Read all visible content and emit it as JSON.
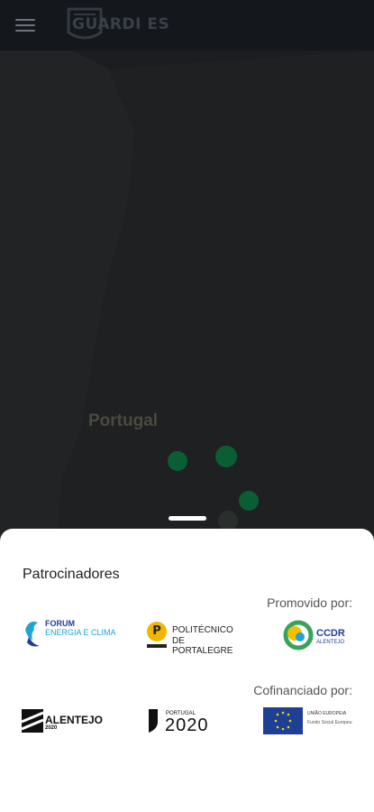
{
  "app": {
    "logo_text": "GUARDI ES"
  },
  "map": {
    "country_label": "Portugal",
    "markers": [
      {
        "name": "marker-1",
        "color": "#0b5e33"
      },
      {
        "name": "marker-2",
        "color": "#0b5e33"
      },
      {
        "name": "marker-3",
        "color": "#0b5e33"
      },
      {
        "name": "marker-4",
        "color": "#2a2e2c"
      }
    ]
  },
  "sheet": {
    "title": "Patrocinadores",
    "promoted_label": "Promovido por:",
    "cofinanced_label": "Cofinanciado por:",
    "promoted": [
      {
        "name": "forum-energia-clima",
        "line1": "FORUM",
        "line2": "ENERGIA E CLIMA"
      },
      {
        "name": "politecnico-portalegre",
        "line1": "POLITÉCNICO",
        "line2": "DE PORTALEGRE",
        "mark": "P"
      },
      {
        "name": "ccdr-alentejo",
        "line1": "CCDR",
        "line2": "ALENTEJO"
      }
    ],
    "cofinanced": [
      {
        "name": "alentejo-2020",
        "line1": "ALENTEJO",
        "line2": "2020"
      },
      {
        "name": "portugal-2020",
        "line1": "PORTUGAL",
        "line2": "2020"
      },
      {
        "name": "uniao-europeia",
        "line1": "UNIÃO EUROPEIA",
        "line2": "Fundo Social Europeu"
      }
    ]
  },
  "colors": {
    "topbar": "#14171c",
    "overlay": "#1c1d1f",
    "sheet": "#ffffff",
    "ccdr_green": "#3aa35a",
    "eu_blue": "#1f3f94"
  }
}
